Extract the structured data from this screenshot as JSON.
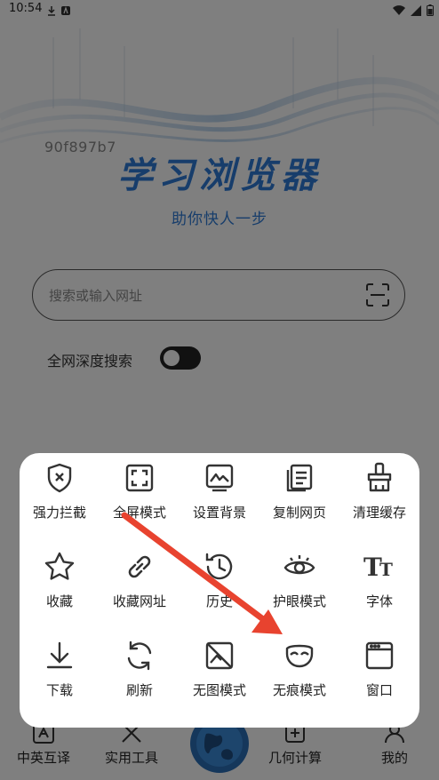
{
  "status_bar": {
    "time": "10:54"
  },
  "hero": {
    "hash_text": "90f897b7",
    "title": "学习浏览器",
    "subtitle": "助你快人一步"
  },
  "search": {
    "placeholder": "搜索或输入网址"
  },
  "deep_search": {
    "label": "全网深度搜索",
    "enabled": false
  },
  "bottom_nav": {
    "items": [
      {
        "label": "中英互译",
        "icon": "translate-icon"
      },
      {
        "label": "实用工具",
        "icon": "tools-icon"
      },
      {
        "label": "",
        "icon": "globe-icon"
      },
      {
        "label": "几何计算",
        "icon": "calculator-icon"
      },
      {
        "label": "我的",
        "icon": "profile-icon"
      }
    ]
  },
  "menu": {
    "items": [
      {
        "label": "强力拦截",
        "icon": "shield-x-icon"
      },
      {
        "label": "全屏模式",
        "icon": "fullscreen-icon"
      },
      {
        "label": "设置背景",
        "icon": "background-icon"
      },
      {
        "label": "复制网页",
        "icon": "copy-icon"
      },
      {
        "label": "清理缓存",
        "icon": "brush-icon"
      },
      {
        "label": "收藏",
        "icon": "star-icon"
      },
      {
        "label": "收藏网址",
        "icon": "link-icon"
      },
      {
        "label": "历史",
        "icon": "history-icon"
      },
      {
        "label": "护眼模式",
        "icon": "eye-icon"
      },
      {
        "label": "字体",
        "icon": "font-icon"
      },
      {
        "label": "下载",
        "icon": "download-icon"
      },
      {
        "label": "刷新",
        "icon": "refresh-icon"
      },
      {
        "label": "无图模式",
        "icon": "no-image-icon"
      },
      {
        "label": "无痕模式",
        "icon": "mask-icon"
      },
      {
        "label": "窗口",
        "icon": "window-icon"
      }
    ]
  },
  "colors": {
    "brand_blue": "#2e7bd6",
    "overlay": "rgba(0,0,0,0.5)",
    "arrow_red": "#e8432f"
  }
}
